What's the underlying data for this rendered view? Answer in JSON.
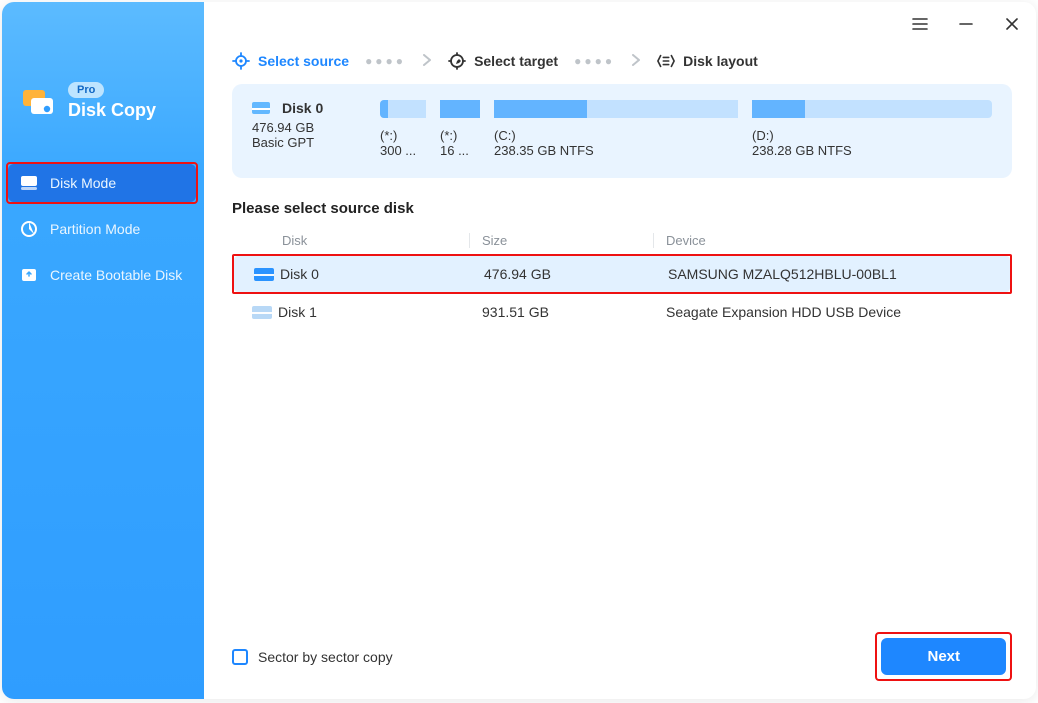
{
  "brand": {
    "badge": "Pro",
    "name": "Disk Copy"
  },
  "sidebar": {
    "items": [
      {
        "label": "Disk Mode",
        "active": true
      },
      {
        "label": "Partition Mode",
        "active": false
      },
      {
        "label": "Create Bootable Disk",
        "active": false
      }
    ]
  },
  "steps": {
    "source": "Select source",
    "target": "Select target",
    "layout": "Disk layout"
  },
  "disk_card": {
    "name": "Disk 0",
    "size": "476.94 GB",
    "scheme": "Basic GPT",
    "partitions": [
      {
        "drive": "(*:)",
        "desc": "300 ..."
      },
      {
        "drive": "(*:)",
        "desc": "16 ..."
      },
      {
        "drive": "(C:)",
        "desc": "238.35 GB NTFS"
      },
      {
        "drive": "(D:)",
        "desc": "238.28 GB NTFS"
      }
    ]
  },
  "prompt": "Please select source disk",
  "table": {
    "headers": {
      "disk": "Disk",
      "size": "Size",
      "device": "Device"
    },
    "rows": [
      {
        "name": "Disk 0",
        "size": "476.94 GB",
        "device": "SAMSUNG MZALQ512HBLU-00BL1",
        "selected": true
      },
      {
        "name": "Disk 1",
        "size": "931.51 GB",
        "device": "Seagate  Expansion HDD   USB Device",
        "selected": false
      }
    ]
  },
  "footer": {
    "checkbox_label": "Sector by sector copy",
    "next": "Next"
  }
}
